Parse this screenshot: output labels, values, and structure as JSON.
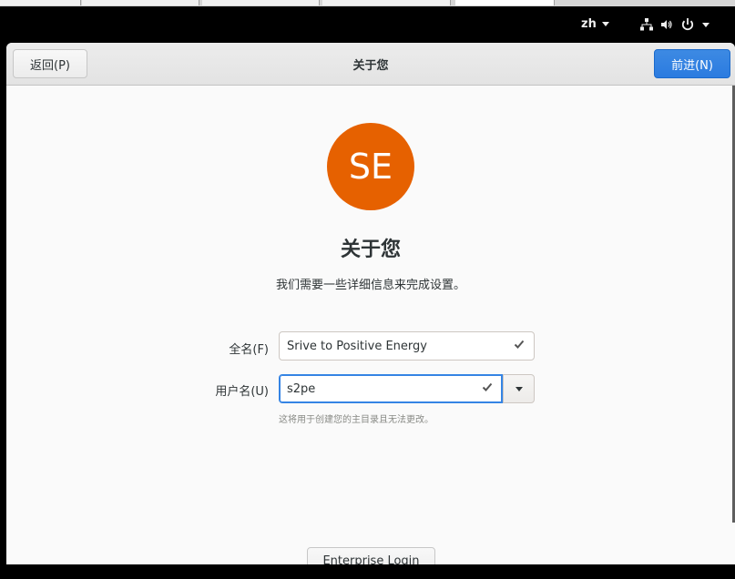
{
  "topbar": {
    "language": "zh",
    "icons": [
      "network-icon",
      "volume-icon",
      "power-icon",
      "chevron-down-icon"
    ]
  },
  "window": {
    "title": "关于您",
    "back_label": "返回(P)",
    "next_label": "前进(N)"
  },
  "avatar": {
    "initials": "SE",
    "color": "#e66100"
  },
  "page": {
    "heading": "关于您",
    "subheading": "我们需要一些详细信息来完成设置。"
  },
  "form": {
    "fullname_label": "全名(F)",
    "fullname_value": "Srive to Positive Energy",
    "username_label": "用户名(U)",
    "username_value": "s2pe",
    "hint": "这将用于创建您的主目录且无法更改。"
  },
  "enterprise_label": "Enterprise Login",
  "colors": {
    "accent": "#3584e4",
    "suggested_button": "#2b7be0"
  }
}
